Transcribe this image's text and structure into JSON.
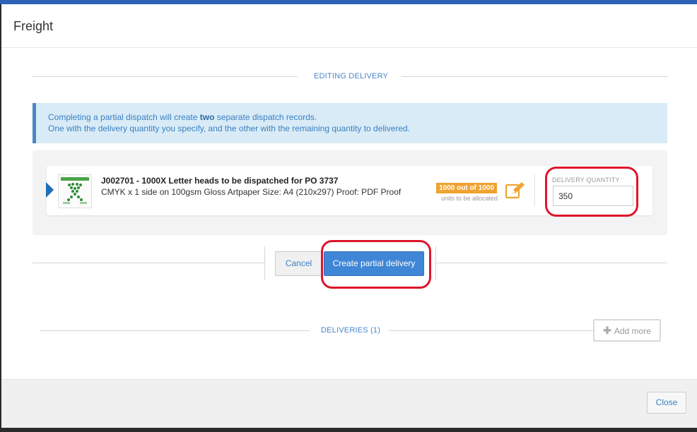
{
  "modal": {
    "title": "Freight"
  },
  "editing_section": {
    "label": "EDITING DELIVERY"
  },
  "info": {
    "line1_before": "Completing a partial dispatch will create ",
    "line1_bold": "two",
    "line1_after": " separate dispatch records.",
    "line2": "One with the delivery quantity you specify, and the other with the remaining quantity to delivered."
  },
  "item": {
    "title": "J002701 - 1000X Letter heads to be dispatched for PO 3737",
    "description": "CMYK x 1 side on 100gsm Gloss Artpaper Size: A4 (210x297) Proof: PDF Proof",
    "allocation_badge": "1000 out of 1000",
    "allocation_sub": "units to be allocated",
    "quantity_label": "DELIVERY QUANTITY",
    "quantity_value": "350"
  },
  "actions": {
    "cancel_label": "Cancel",
    "create_label": "Create partial delivery"
  },
  "deliveries_section": {
    "label": "DELIVERIES (1)",
    "add_more_label": "Add more"
  },
  "footer": {
    "close_label": "Close"
  },
  "colors": {
    "accent": "#3f86d6",
    "badge": "#f0a330",
    "highlight_ring": "#e0142a"
  },
  "icons": [
    "pencil-icon",
    "plus-icon",
    "caret-right-icon"
  ]
}
